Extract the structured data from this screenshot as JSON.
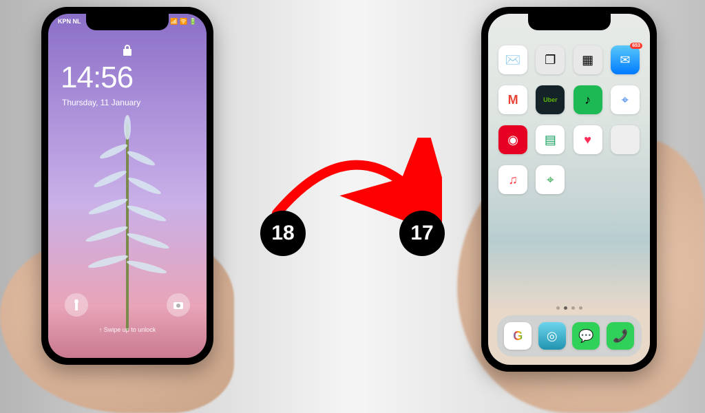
{
  "leftPhone": {
    "carrier": "KPN NL",
    "signalIcons": "📶 🛜 🔋",
    "time": "14:56",
    "date": "Thursday, 11 January",
    "swipeHint": "↑ Swipe up to unlock"
  },
  "rightPhone": {
    "apps": {
      "mail": "✉️",
      "photos": "❐",
      "folder": "▦",
      "mailBadge": "653",
      "gmail": "M",
      "uberEats": "Uber",
      "spotify": "♪",
      "maps1": "⌖",
      "pinterest": "◉",
      "sheets": "▤",
      "health": "♥",
      "blank": " ",
      "music": "♫",
      "googleMaps": "⌖"
    },
    "dock": {
      "google": "G",
      "safari": "◎",
      "messages": "💬",
      "phone": "📞"
    }
  },
  "versions": {
    "from": "18",
    "to": "17"
  }
}
